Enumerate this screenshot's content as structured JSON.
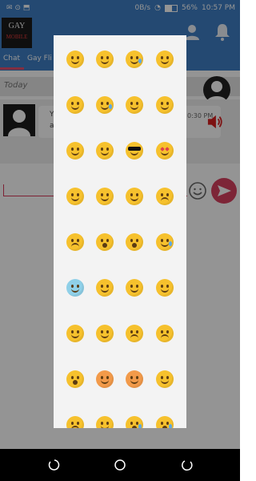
{
  "status_bar": {
    "network_speed": "0B/s",
    "battery_percent": "56%",
    "time": "10:57 PM"
  },
  "app": {
    "logo_text": "GAY",
    "logo_subtext": "MOBILE"
  },
  "tabs": [
    {
      "label": "Chat"
    },
    {
      "label": "Gay Fli"
    }
  ],
  "chat": {
    "date_label": "Today",
    "message_preview_start": "Y",
    "message_preview_line2": "a",
    "message_time": "0:30 PM"
  },
  "emoji_panel": {
    "rows": 9,
    "columns": 4,
    "emojis": [
      [
        "grinning",
        "beaming",
        "tears-of-joy",
        "grinning-big-eyes"
      ],
      [
        "grinning-squint",
        "sweat-smile",
        "laughing",
        "winking"
      ],
      [
        "smiling",
        "yum",
        "sunglasses",
        "heart-eyes"
      ],
      [
        "kissing-heart",
        "expressionless",
        "no-mouth",
        "confounded"
      ],
      [
        "disappointed-relieved",
        "hushed",
        "surprised",
        "sleepy"
      ],
      [
        "fearful",
        "sleeping",
        "relieved",
        "tongue-out"
      ],
      [
        "winking-tongue",
        "squinting-tongue",
        "unamused",
        "confused"
      ],
      [
        "astonished",
        "angry",
        "pouting",
        "kissing"
      ],
      [
        "worried",
        "triumph",
        "crying",
        "sobbing"
      ]
    ]
  }
}
